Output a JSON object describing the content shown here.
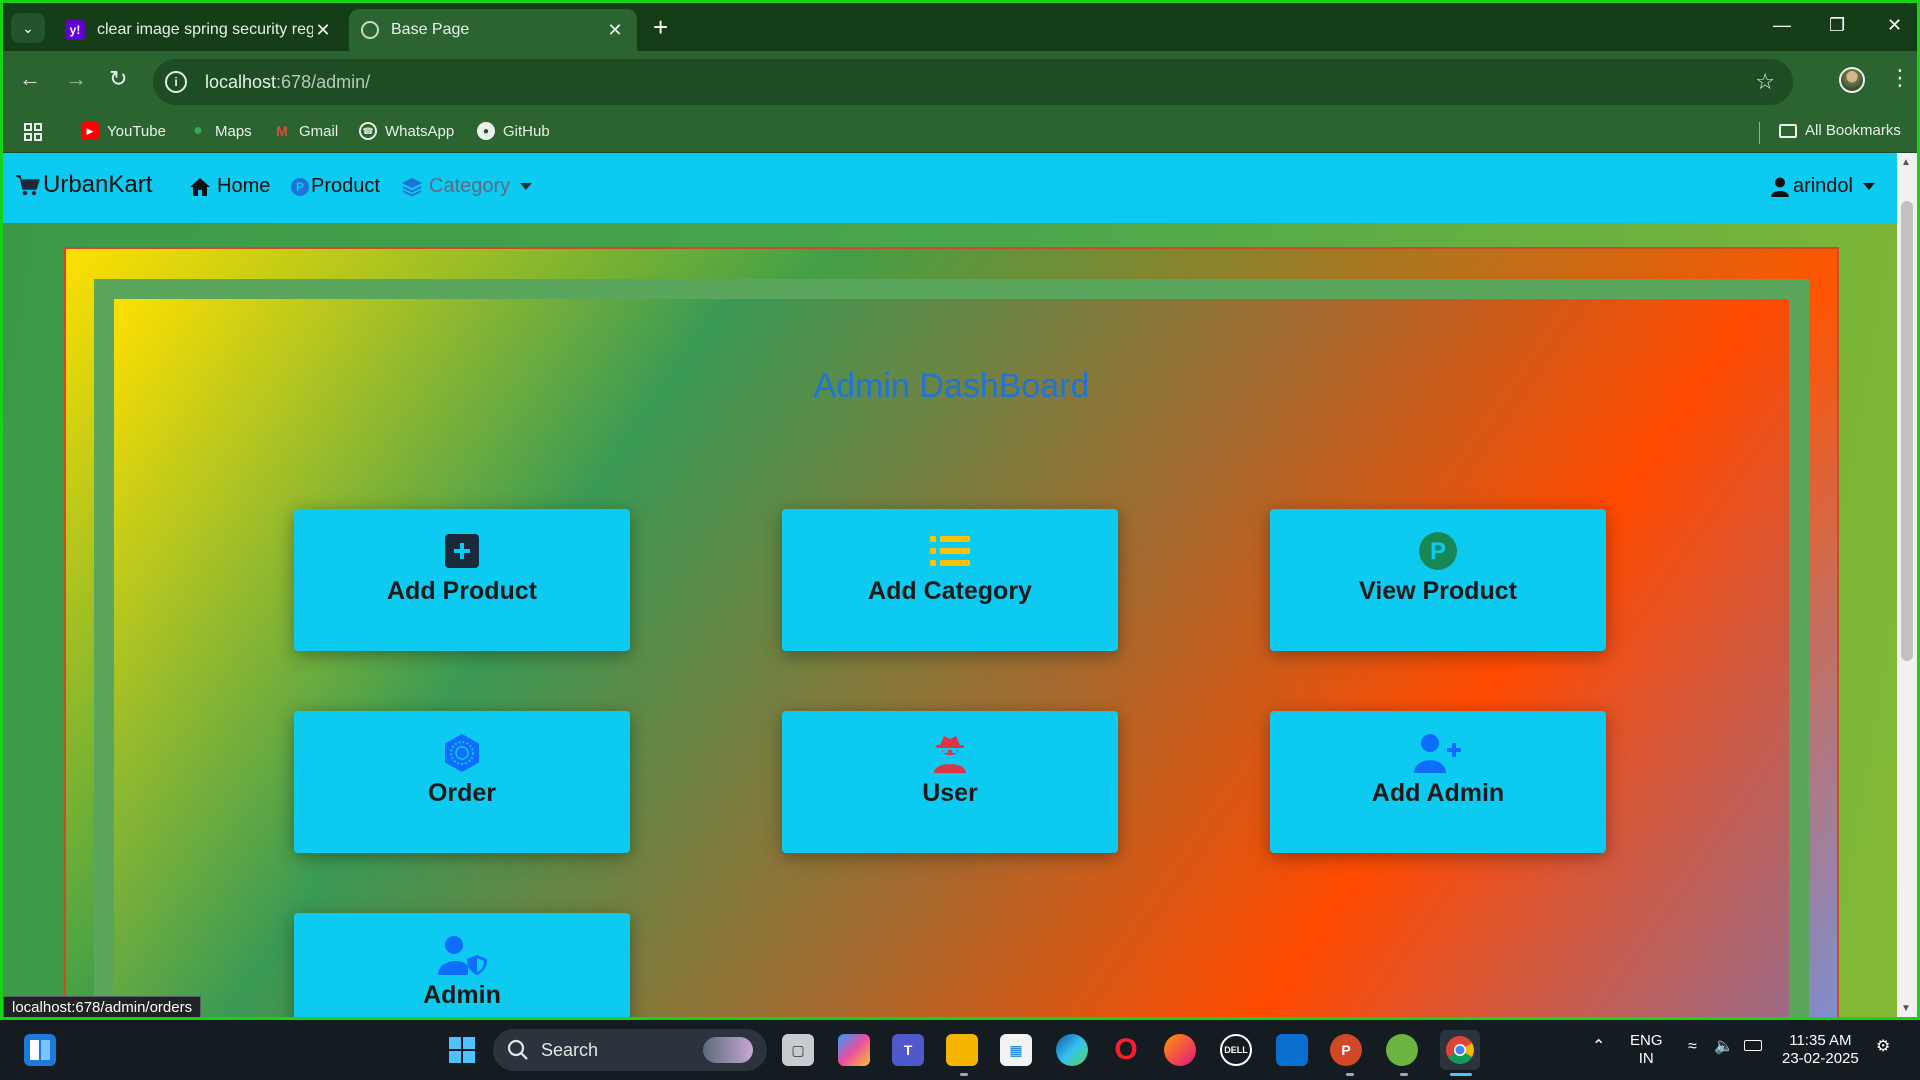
{
  "browser": {
    "tabs": [
      {
        "title": "clear image spring security regi",
        "favicon": "yahoo-icon",
        "active": false
      },
      {
        "title": "Base Page",
        "favicon": "globe-icon",
        "active": true
      }
    ],
    "url_host": "localhost",
    "url_path": ":678/admin/",
    "bookmarks": [
      {
        "label": "YouTube",
        "icon": "youtube-icon",
        "color": "#ff0000"
      },
      {
        "label": "Maps",
        "icon": "maps-icon",
        "color": "#34a853"
      },
      {
        "label": "Gmail",
        "icon": "gmail-icon",
        "color": "#ea4335"
      },
      {
        "label": "WhatsApp",
        "icon": "whatsapp-icon",
        "color": "#25d366"
      },
      {
        "label": "GitHub",
        "icon": "github-icon",
        "color": "#ffffff"
      }
    ],
    "all_bookmarks": "All Bookmarks",
    "status_url": "localhost:678/admin/orders"
  },
  "app": {
    "brand": "UrbanKart",
    "nav": {
      "home": "Home",
      "product": "Product",
      "category": "Category",
      "user": "arindol"
    },
    "dashboard_title": "Admin DashBoard",
    "cards": [
      {
        "label": "Add Product",
        "icon": "plus-square-icon",
        "color": "#1a2a3a"
      },
      {
        "label": "Add Category",
        "icon": "list-icon",
        "color": "#ffc107"
      },
      {
        "label": "View Product",
        "icon": "product-p-icon",
        "color": "#198754"
      },
      {
        "label": "Order",
        "icon": "order-badge-icon",
        "color": "#0d6efd"
      },
      {
        "label": "User",
        "icon": "user-secret-icon",
        "color": "#dc3545"
      },
      {
        "label": "Add Admin",
        "icon": "user-plus-icon",
        "color": "#0d6efd"
      },
      {
        "label": "Admin",
        "icon": "user-shield-icon",
        "color": "#0d6efd"
      }
    ]
  },
  "taskbar": {
    "search_placeholder": "Search",
    "lang": "ENG",
    "region": "IN",
    "time": "11:35 AM",
    "date": "23-02-2025"
  }
}
